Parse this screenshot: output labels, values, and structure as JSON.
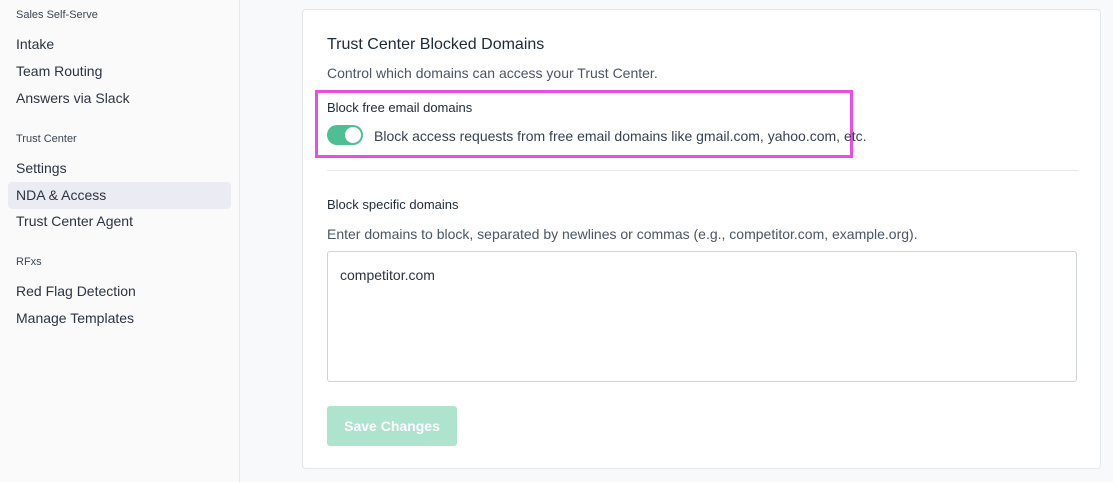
{
  "sidebar": {
    "sections": [
      {
        "title": "Sales Self-Serve",
        "items": [
          "Intake",
          "Team Routing",
          "Answers via Slack"
        ]
      },
      {
        "title": "Trust Center",
        "items": [
          "Settings",
          "NDA & Access",
          "Trust Center Agent"
        ]
      },
      {
        "title": "RFxs",
        "items": [
          "Red Flag Detection",
          "Manage Templates"
        ]
      }
    ],
    "active_item": "NDA & Access"
  },
  "card": {
    "title": "Trust Center Blocked Domains",
    "subtitle": "Control which domains can access your Trust Center.",
    "free_email": {
      "label": "Block free email domains",
      "toggle_on": true,
      "description": "Block access requests from free email domains like gmail.com, yahoo.com, etc."
    },
    "specific": {
      "label": "Block specific domains",
      "description": "Enter domains to block, separated by newlines or commas (e.g., competitor.com, example.org).",
      "value": "competitor.com"
    },
    "save_label": "Save Changes"
  },
  "colors": {
    "toggle_on": "#4fbf93",
    "save_button_disabled": "#aee3cd",
    "highlight_border": "#e84ee4",
    "active_nav_bg": "#ebebf3"
  }
}
